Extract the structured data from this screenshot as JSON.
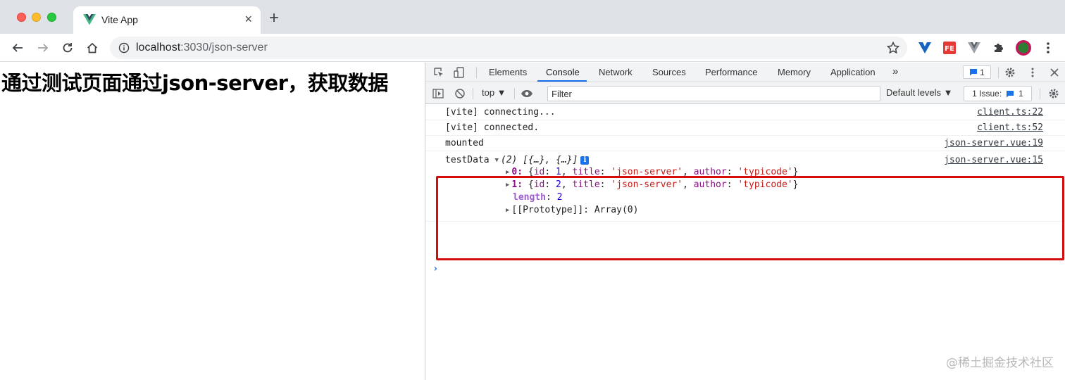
{
  "browser": {
    "tab_title": "Vite App",
    "tab_close": "×",
    "new_tab": "+",
    "url_host": "localhost",
    "url_path": ":3030/json-server"
  },
  "page": {
    "heading": "通过测试页面通过json-server，获取数据"
  },
  "devtools": {
    "tabs": [
      "Elements",
      "Console",
      "Network",
      "Sources",
      "Performance",
      "Memory",
      "Application"
    ],
    "active_tab": "Console",
    "more_tabs": "»",
    "message_count": "1",
    "context": "top ▼",
    "filter_placeholder": "Filter",
    "levels": "Default levels ▼",
    "issues_label": "1 Issue:",
    "issues_count": "1"
  },
  "console": {
    "rows": [
      {
        "message": "[vite] connecting...",
        "source": "client.ts:22"
      },
      {
        "message": "[vite] connected.",
        "source": "client.ts:52"
      },
      {
        "message": "mounted",
        "source": "json-server.vue:19"
      }
    ],
    "testdata": {
      "label": "testData",
      "preview": "(2) [{…}, {…}]",
      "info": "i",
      "source": "json-server.vue:15",
      "items": [
        {
          "index": "0",
          "id": "1",
          "title": "'json-server'",
          "author": "'typicode'"
        },
        {
          "index": "1",
          "id": "2",
          "title": "'json-server'",
          "author": "'typicode'"
        }
      ],
      "length_key": "length",
      "length_value": "2",
      "prototype": "[[Prototype]]: Array(0)"
    },
    "prompt": "›"
  },
  "watermark": "@稀土掘金技术社区",
  "colors": {
    "highlight": "#d50c0c",
    "accent": "#1a73e8",
    "vue_green": "#41b883"
  }
}
